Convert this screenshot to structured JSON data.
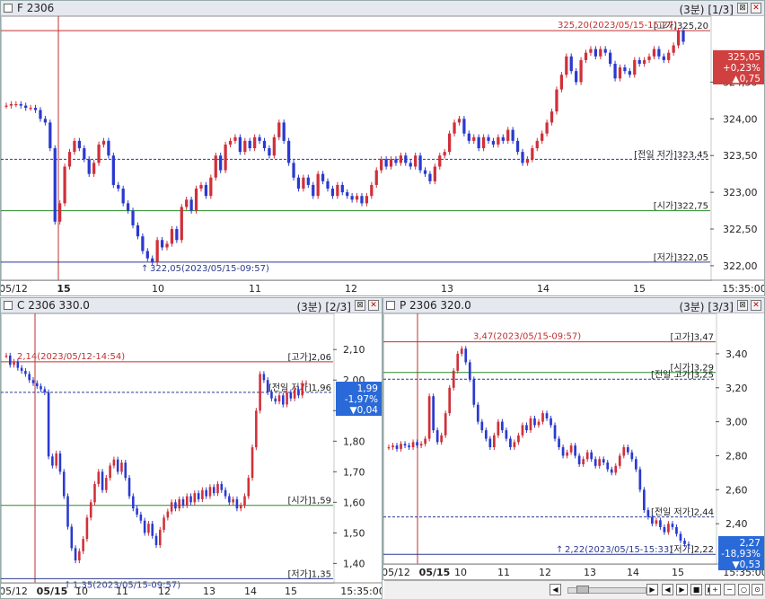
{
  "chart_data": [
    {
      "id": "F",
      "type": "candlestick",
      "title": "F 2306",
      "interval": "(3분)",
      "page": "[1/3]",
      "ylim": [
        321.95,
        325.3
      ],
      "yticks": [
        322.0,
        322.5,
        323.0,
        323.5,
        324.0,
        324.5
      ],
      "ytick_labels": [
        "322,00",
        "322,50",
        "323,00",
        "323,50",
        "324,00",
        "324,50"
      ],
      "xticks": [
        "05/12",
        "15",
        "10",
        "11",
        "12",
        "13",
        "14",
        "15",
        "15:35:00"
      ],
      "levels": [
        {
          "name": "high",
          "value": 325.2,
          "text": "[고가]325,20",
          "color": "#c03030"
        },
        {
          "name": "prev-low",
          "value": 323.45,
          "text": "[전일 저가]323,45",
          "color": "#2a3a90",
          "dashed": true
        },
        {
          "name": "open",
          "value": 322.75,
          "text": "[시가]322,75",
          "color": "#2a8a2a"
        },
        {
          "name": "low",
          "value": 322.05,
          "text": "[저가]322,05",
          "color": "#2a3a90"
        }
      ],
      "high_note": "325,20(2023/05/15-15:27)",
      "low_note": "322,05(2023/05/15-09:57)",
      "low_arrow": "↑",
      "price_box": {
        "price": "325,05",
        "change_pct": "+0,23%",
        "change": "▲0,75",
        "color": "#d04040"
      },
      "candles": [
        324.18,
        324.2,
        324.2,
        324.18,
        324.15,
        324.15,
        324.12,
        324.0,
        323.95,
        323.6,
        322.6,
        322.85,
        323.35,
        323.55,
        323.7,
        323.6,
        323.45,
        323.25,
        323.4,
        323.65,
        323.7,
        323.5,
        323.1,
        323.05,
        322.85,
        322.75,
        322.55,
        322.4,
        322.2,
        322.1,
        322.05,
        322.35,
        322.25,
        322.3,
        322.5,
        322.35,
        322.8,
        322.9,
        322.75,
        323.05,
        323.1,
        322.95,
        323.2,
        323.5,
        323.3,
        323.65,
        323.7,
        323.75,
        323.55,
        323.7,
        323.6,
        323.75,
        323.7,
        323.6,
        323.5,
        323.75,
        323.95,
        323.7,
        323.4,
        323.2,
        323.05,
        323.2,
        323.1,
        322.95,
        323.25,
        323.15,
        323.05,
        322.95,
        323.1,
        323.0,
        322.95,
        322.9,
        322.95,
        322.85,
        322.95,
        323.1,
        323.3,
        323.45,
        323.35,
        323.45,
        323.4,
        323.5,
        323.4,
        323.35,
        323.5,
        323.3,
        323.25,
        323.15,
        323.35,
        323.5,
        323.55,
        323.8,
        323.95,
        324.0,
        323.8,
        323.7,
        323.75,
        323.6,
        323.75,
        323.7,
        323.65,
        323.75,
        323.7,
        323.85,
        323.7,
        323.55,
        323.4,
        323.45,
        323.6,
        323.7,
        323.8,
        323.95,
        324.1,
        324.4,
        324.6,
        324.85,
        324.65,
        324.5,
        324.8,
        324.9,
        324.95,
        324.85,
        324.95,
        324.9,
        324.75,
        324.55,
        324.7,
        324.65,
        324.6,
        324.8,
        324.75,
        324.8,
        324.85,
        324.95,
        324.85,
        324.8,
        324.9,
        325.0,
        325.2,
        325.05
      ]
    },
    {
      "id": "C",
      "type": "candlestick",
      "title": "C 2306 330.0",
      "interval": "(3분)",
      "page": "[2/3]",
      "ylim": [
        1.36,
        2.13
      ],
      "yticks": [
        1.4,
        1.5,
        1.6,
        1.7,
        1.8,
        1.9,
        2.0,
        2.1
      ],
      "ytick_labels": [
        "1,40",
        "1,50",
        "1,60",
        "1,70",
        "1,80",
        "1,90",
        "2,00",
        "2,10"
      ],
      "xticks": [
        "05/12",
        "05/15",
        "10",
        "11",
        "12",
        "13",
        "14",
        "15",
        "15:35:00"
      ],
      "levels": [
        {
          "name": "high",
          "value": 2.06,
          "text": "[고가]2,06",
          "color": "#c03030"
        },
        {
          "name": "prev-high",
          "value": 1.96,
          "text": "[전일 저가]1,96",
          "color": "#2a3a90",
          "dashed": true
        },
        {
          "name": "open",
          "value": 1.59,
          "text": "[시가]1,59",
          "color": "#2a8a2a"
        },
        {
          "name": "low",
          "value": 1.35,
          "text": "[저가]1,35",
          "color": "#2a3a90"
        }
      ],
      "high_note": "2,14(2023/05/12-14:54)",
      "low_note": "1,35(2023/05/15-09:57)",
      "low_arrow": "↑",
      "price_box": {
        "price": "1,99",
        "change_pct": "-1,97%",
        "change": "▼0,04",
        "color": "#2a6ad8"
      },
      "candles": [
        2.08,
        2.05,
        2.06,
        2.04,
        2.03,
        2.02,
        2.0,
        1.99,
        1.98,
        1.97,
        1.96,
        1.75,
        1.72,
        1.76,
        1.7,
        1.62,
        1.52,
        1.45,
        1.41,
        1.44,
        1.48,
        1.55,
        1.6,
        1.66,
        1.7,
        1.64,
        1.68,
        1.72,
        1.74,
        1.7,
        1.73,
        1.68,
        1.62,
        1.58,
        1.56,
        1.54,
        1.5,
        1.53,
        1.49,
        1.46,
        1.51,
        1.55,
        1.57,
        1.6,
        1.58,
        1.61,
        1.59,
        1.62,
        1.6,
        1.63,
        1.61,
        1.64,
        1.62,
        1.65,
        1.63,
        1.66,
        1.64,
        1.62,
        1.6,
        1.61,
        1.58,
        1.59,
        1.62,
        1.68,
        1.78,
        1.9,
        2.02,
        2.0,
        1.96,
        1.94,
        1.93,
        1.95,
        1.92,
        1.96,
        1.94,
        1.97,
        1.95,
        1.99,
        1.99
      ]
    },
    {
      "id": "P",
      "type": "candlestick",
      "title": "P 2306 320.0",
      "interval": "(3분)",
      "page": "[3/3]",
      "ylim": [
        2.2,
        3.5
      ],
      "yticks": [
        2.4,
        2.6,
        2.8,
        3.0,
        3.2,
        3.4
      ],
      "ytick_labels": [
        "2,40",
        "2,60",
        "2,80",
        "3,00",
        "3,20",
        "3,40"
      ],
      "xticks": [
        "05/12",
        "05/15",
        "10",
        "11",
        "12",
        "13",
        "14",
        "15",
        "15:35:00"
      ],
      "levels": [
        {
          "name": "high",
          "value": 3.47,
          "text": "[고가]3,47",
          "color": "#c03030"
        },
        {
          "name": "open",
          "value": 3.29,
          "text": "[시가]3,29",
          "color": "#2a8a2a"
        },
        {
          "name": "prev-high",
          "value": 3.25,
          "text": "[전일 고가]3,25",
          "color": "#2a3a90",
          "dashed": true
        },
        {
          "name": "prev-low",
          "value": 2.44,
          "text": "[전일 저가]2,44",
          "color": "#2a3a90",
          "dashed": true
        },
        {
          "name": "low",
          "value": 2.22,
          "text": "[저가]2,22",
          "color": "#2a3a90"
        }
      ],
      "high_note": "3,47(2023/05/15-09:57)",
      "low_note": "2,22(2023/05/15-15:33)",
      "low_arrow": "↑",
      "price_box": {
        "price": "2,27",
        "change_pct": "-18,93%",
        "change": "▼0,53",
        "color": "#2a6ad8"
      },
      "candles": [
        2.85,
        2.86,
        2.84,
        2.87,
        2.86,
        2.85,
        2.88,
        2.86,
        2.87,
        2.9,
        3.15,
        2.95,
        2.88,
        2.92,
        3.05,
        3.2,
        3.3,
        3.4,
        3.43,
        3.35,
        3.25,
        3.1,
        3.0,
        2.95,
        2.9,
        2.85,
        2.92,
        3.0,
        2.95,
        2.9,
        2.85,
        2.88,
        2.92,
        2.98,
        2.95,
        3.02,
        2.98,
        3.0,
        3.05,
        3.02,
        2.98,
        2.9,
        2.85,
        2.8,
        2.82,
        2.86,
        2.8,
        2.75,
        2.78,
        2.82,
        2.78,
        2.74,
        2.78,
        2.76,
        2.72,
        2.7,
        2.74,
        2.8,
        2.85,
        2.82,
        2.78,
        2.72,
        2.6,
        2.48,
        2.44,
        2.4,
        2.42,
        2.38,
        2.35,
        2.4,
        2.38,
        2.34,
        2.3,
        2.28,
        2.27
      ]
    }
  ],
  "toolbar": {
    "prev_label": "◀",
    "next_label": "▶",
    "first_label": "◀",
    "play_label": "▶",
    "stop_label": "■",
    "last_label": "▶",
    "zoom_in_label": "+",
    "zoom_out_label": "−",
    "zoom_reset_label": "○",
    "zoom_fit_label": "⊙"
  }
}
